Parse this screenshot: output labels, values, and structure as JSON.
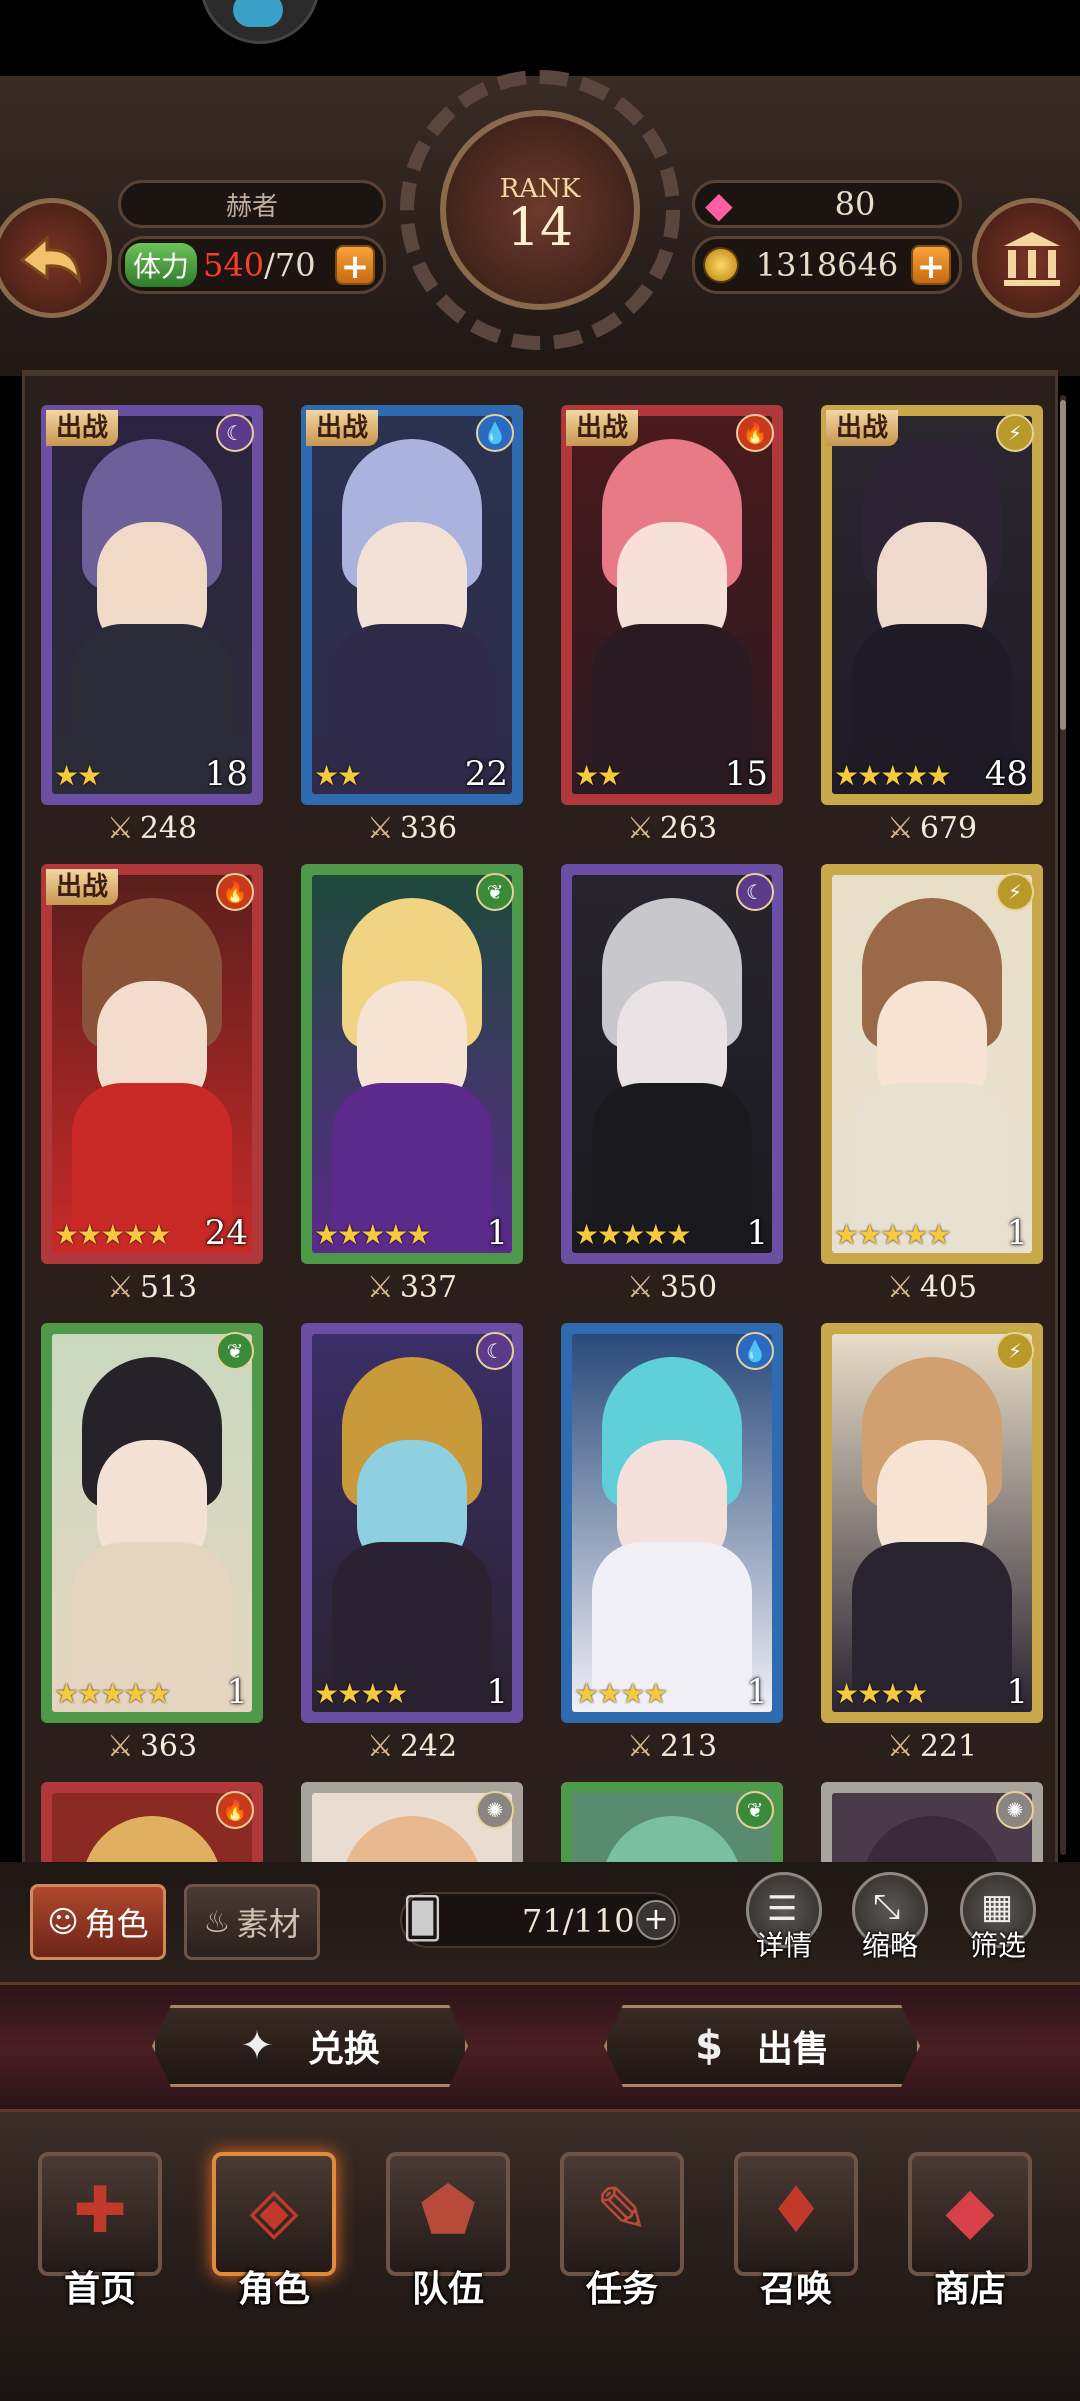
{
  "header": {
    "player_name": "赫者",
    "rank_label": "RANK",
    "rank_value": "14",
    "stamina_label": "体力",
    "stamina_current": "540",
    "stamina_max": "/70",
    "gems": "80",
    "gold": "1318646",
    "plus": "+"
  },
  "cards": [
    {
      "badge": "出战",
      "element": "dark",
      "stars": "★★",
      "level": "18",
      "power": "248",
      "frame": "#6b4fa5",
      "bg": "#2a2340",
      "hair": "#6d5f9a",
      "skin": "#f1d9c8",
      "outfit": "#2c2c38"
    },
    {
      "badge": "出战",
      "element": "water",
      "stars": "★★",
      "level": "22",
      "power": "336",
      "frame": "#2f6bb0",
      "bg": "#2a3350",
      "hair": "#a9b3dd",
      "skin": "#f3e0d6",
      "outfit": "#2e2a48"
    },
    {
      "badge": "出战",
      "element": "fire",
      "stars": "★★",
      "level": "15",
      "power": "263",
      "frame": "#b0383a",
      "bg": "#4a1a1c",
      "hair": "#e77a86",
      "skin": "#f7e0d8",
      "outfit": "#2a1a22"
    },
    {
      "badge": "出战",
      "element": "thunder",
      "stars": "★★★★★",
      "level": "48",
      "power": "679",
      "frame": "#c7a94a",
      "bg": "#2b2730",
      "hair": "#2c2435",
      "skin": "#efd8cc",
      "outfit": "#1e1b26"
    },
    {
      "badge": "出战",
      "element": "fire",
      "stars": "★★★★★",
      "level": "24",
      "power": "513",
      "frame": "#b0383a",
      "bg": "#5a1f1c",
      "hair": "#8a5238",
      "skin": "#f4dccc",
      "outfit": "#c92a28"
    },
    {
      "badge": "",
      "element": "wood",
      "stars": "★★★★★",
      "level": "1",
      "power": "337",
      "frame": "#4f9a4a",
      "bg": "#1d4a3a",
      "hair": "#f1d384",
      "skin": "#f6e3d3",
      "outfit": "#5b2a8a"
    },
    {
      "badge": "",
      "element": "dark",
      "stars": "★★★★★",
      "level": "1",
      "power": "350",
      "frame": "#6b4fa5",
      "bg": "#28242e",
      "hair": "#c7c7cc",
      "skin": "#e9e3e6",
      "outfit": "#1a1a1e"
    },
    {
      "badge": "",
      "element": "thunder",
      "stars": "★★★★★",
      "level": "1",
      "power": "405",
      "frame": "#c7a94a",
      "bg": "#e7dfc8",
      "hair": "#9a6a48",
      "skin": "#f6e3d3",
      "outfit": "#e8e0d0"
    },
    {
      "badge": "",
      "element": "wood",
      "stars": "★★★★★",
      "level": "1",
      "power": "363",
      "frame": "#4f9a4a",
      "bg": "#c9d9c0",
      "hair": "#26222a",
      "skin": "#f4e1d5",
      "outfit": "#e6d5c0"
    },
    {
      "badge": "",
      "element": "dark",
      "stars": "★★★★",
      "level": "1",
      "power": "242",
      "frame": "#6b4fa5",
      "bg": "#3a2f66",
      "hair": "#c99a3a",
      "skin": "#8fd0e0",
      "outfit": "#2a2230"
    },
    {
      "badge": "",
      "element": "water",
      "stars": "★★★★",
      "level": "1",
      "power": "213",
      "frame": "#2f6bb0",
      "bg": "#2a4a7a",
      "hair": "#5fcfd8",
      "skin": "#f4e1dc",
      "outfit": "#f0f0f6"
    },
    {
      "badge": "",
      "element": "thunder",
      "stars": "★★★★",
      "level": "1",
      "power": "221",
      "frame": "#c7a94a",
      "bg": "#e8ddc8",
      "hair": "#d0a070",
      "skin": "#f6e3d3",
      "outfit": "#2a2430"
    },
    {
      "badge": "",
      "element": "fire",
      "stars": "",
      "level": "",
      "power": "",
      "frame": "#b0383a",
      "bg": "#8a2a22",
      "hair": "#e0b060",
      "skin": "#f4dccc",
      "outfit": "#8a2a22"
    },
    {
      "badge": "",
      "element": "light",
      "stars": "",
      "level": "",
      "power": "",
      "frame": "#a8a49c",
      "bg": "#eadcd0",
      "hair": "#e8b890",
      "skin": "#f6e3d3",
      "outfit": "#eadcd0"
    },
    {
      "badge": "",
      "element": "wood",
      "stars": "",
      "level": "",
      "power": "",
      "frame": "#4f9a4a",
      "bg": "#5a8a70",
      "hair": "#7ac0a0",
      "skin": "#f4dccc",
      "outfit": "#5a8a70"
    },
    {
      "badge": "",
      "element": "light",
      "stars": "",
      "level": "",
      "power": "",
      "frame": "#a8a49c",
      "bg": "#4a3a4a",
      "hair": "#3a2a3a",
      "skin": "#f4dccc",
      "outfit": "#4a3a4a"
    }
  ],
  "toolbar": {
    "tab_character": "角色",
    "tab_material": "素材",
    "capacity": "71/110",
    "details": "详情",
    "thumbnail": "缩略",
    "filter": "筛选"
  },
  "actions": {
    "exchange": "兑换",
    "sell": "出售"
  },
  "nav": [
    {
      "label": "首页"
    },
    {
      "label": "角色"
    },
    {
      "label": "队伍"
    },
    {
      "label": "任务"
    },
    {
      "label": "召唤"
    },
    {
      "label": "商店"
    }
  ],
  "colors": {
    "accent_gold": "#d8b78a",
    "stamina_red": "#ff3b30",
    "star_yellow": "#f6c93e",
    "button_orange": "#f7a23a"
  }
}
